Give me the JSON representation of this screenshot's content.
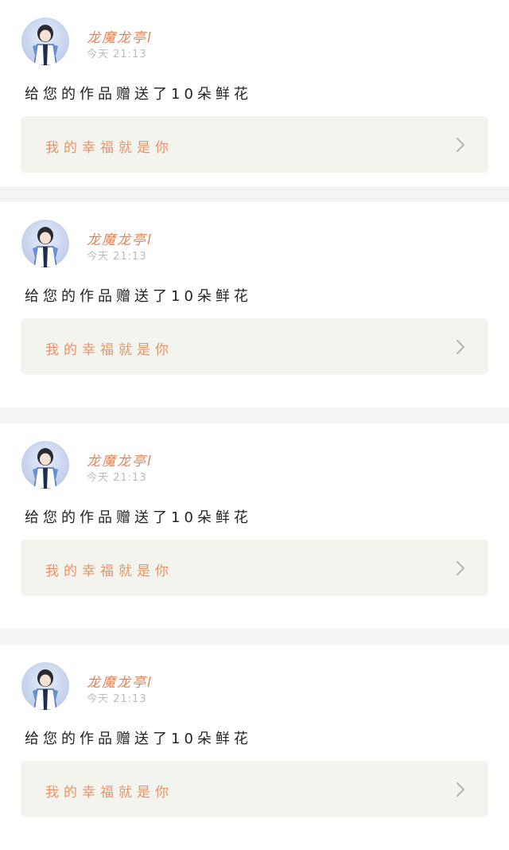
{
  "feed": [
    {
      "user_name": "龙魔龙亭l",
      "time": "今天 21:13",
      "message": "给您的作品赠送了10朵鲜花",
      "gift_text": "我的幸福就是你",
      "avatar_icon": "anime-avatar-icon",
      "chevron_icon": "chevron-right-icon"
    },
    {
      "user_name": "龙魔龙亭l",
      "time": "今天 21:13",
      "message": "给您的作品赠送了10朵鲜花",
      "gift_text": "我的幸福就是你",
      "avatar_icon": "anime-avatar-icon",
      "chevron_icon": "chevron-right-icon"
    },
    {
      "user_name": "龙魔龙亭l",
      "time": "今天 21:13",
      "message": "给您的作品赠送了10朵鲜花",
      "gift_text": "我的幸福就是你",
      "avatar_icon": "anime-avatar-icon",
      "chevron_icon": "chevron-right-icon"
    },
    {
      "user_name": "龙魔龙亭l",
      "time": "今天 21:13",
      "message": "给您的作品赠送了10朵鲜花",
      "gift_text": "我的幸福就是你",
      "avatar_icon": "anime-avatar-icon",
      "chevron_icon": "chevron-right-icon"
    }
  ],
  "colors": {
    "user_name": "#e2845a",
    "gift_text": "#e6946b",
    "gift_background": "#f4f4ee",
    "separator": "#f4f4f4"
  }
}
